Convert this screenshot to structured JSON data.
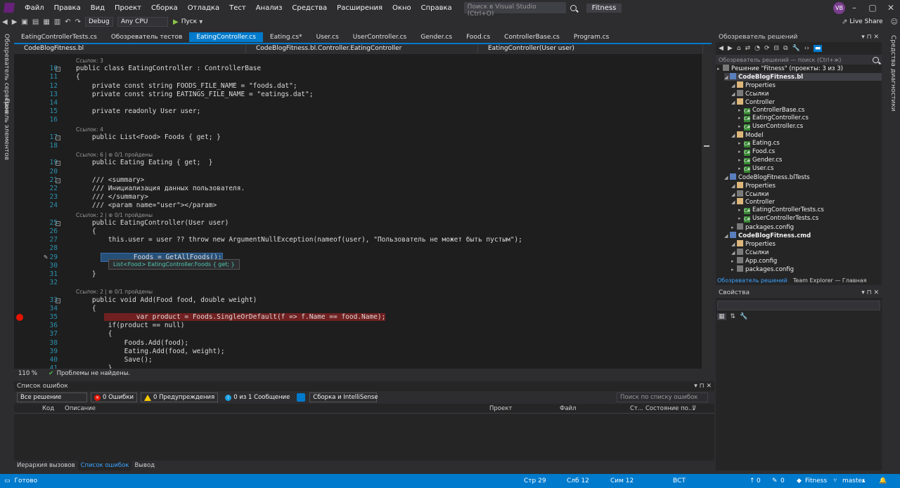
{
  "menu": [
    "Файл",
    "Правка",
    "Вид",
    "Проект",
    "Сборка",
    "Отладка",
    "Тест",
    "Анализ",
    "Средства",
    "Расширения",
    "Окно",
    "Справка"
  ],
  "search_placeholder": "Поиск в Visual Studio (Ctrl+Q)",
  "solution_title": "Fitness",
  "avatar_initials": "VB",
  "live_share": "Live Share",
  "toolbar": {
    "config": "Debug",
    "platform": "Any CPU",
    "run_label": "Пуск"
  },
  "doc_tabs": [
    "EatingControllerTests.cs",
    "Обозреватель тестов",
    "EatingController.cs",
    "Eating.cs*",
    "User.cs",
    "UserController.cs",
    "Gender.cs",
    "Food.cs",
    "ControllerBase.cs",
    "Program.cs"
  ],
  "nav": {
    "project": "CodeBlogFitness.bl",
    "class": "CodeBlogFitness.bl.Controller.EatingController",
    "member": "EatingController(User user)"
  },
  "left_strip": [
    "Обозреватель серверов",
    "Панель элементов"
  ],
  "right_strip": "Средства диагностики",
  "code_lines": [
    {
      "n": "",
      "lens": "Ссылок: 3"
    },
    {
      "n": "10",
      "text": "public class EatingController : ControllerBase"
    },
    {
      "n": "11",
      "text": "{"
    },
    {
      "n": "12",
      "text": "    private const string FOODS_FILE_NAME = \"foods.dat\";"
    },
    {
      "n": "13",
      "text": "    private const string EATINGS_FILE_NAME = \"eatings.dat\";"
    },
    {
      "n": "14",
      "text": ""
    },
    {
      "n": "15",
      "text": "    private readonly User user;"
    },
    {
      "n": "16",
      "text": ""
    },
    {
      "n": "",
      "lens": "Ссылок: 4"
    },
    {
      "n": "17",
      "text": "    public List<Food> Foods { get; }"
    },
    {
      "n": "18",
      "text": ""
    },
    {
      "n": "",
      "lens": "Ссылок: 6 | ⊗ 0/1 пройдены"
    },
    {
      "n": "19",
      "text": "    public Eating Eating { get;  }"
    },
    {
      "n": "20",
      "text": ""
    },
    {
      "n": "21",
      "text": "    /// <summary>"
    },
    {
      "n": "22",
      "text": "    /// Инициализация данных пользователя."
    },
    {
      "n": "23",
      "text": "    /// </summary>"
    },
    {
      "n": "24",
      "text": "    /// <param name=\"user\"></param>"
    },
    {
      "n": "",
      "lens": "Ссылок: 2 | ⊗ 0/1 пройдены"
    },
    {
      "n": "25",
      "text": "    public EatingController(User user)"
    },
    {
      "n": "26",
      "text": "    {"
    },
    {
      "n": "27",
      "text": "        this.user = user ?? throw new ArgumentNullException(nameof(user), \"Пользователь не может быть пустым\");"
    },
    {
      "n": "28",
      "text": ""
    },
    {
      "n": "29",
      "text": "        Foods = GetAllFoods();"
    },
    {
      "n": "30",
      "text": "        E"
    },
    {
      "n": "31",
      "text": "    }"
    },
    {
      "n": "32",
      "text": ""
    },
    {
      "n": "",
      "lens": "Ссылок: 2 | ⊗ 0/1 пройдены"
    },
    {
      "n": "33",
      "text": "    public void Add(Food food, double weight)"
    },
    {
      "n": "34",
      "text": "    {"
    },
    {
      "n": "35",
      "text": "        var product = Foods.SingleOrDefault(f => f.Name == food.Name);"
    },
    {
      "n": "36",
      "text": "        if(product == null)"
    },
    {
      "n": "37",
      "text": "        {"
    },
    {
      "n": "38",
      "text": "            Foods.Add(food);"
    },
    {
      "n": "39",
      "text": "            Eating.Add(food, weight);"
    },
    {
      "n": "40",
      "text": "            Save();"
    },
    {
      "n": "41",
      "text": "        }"
    }
  ],
  "tooltip": "List<Food> EatingController.Foods { get; }",
  "editor_status": {
    "zoom": "110 %",
    "problems": "Проблемы не найдены."
  },
  "error_list": {
    "title": "Список ошибок",
    "scope": "Все решение",
    "errors": "0 Ошибки",
    "warnings": "0 Предупреждения",
    "messages": "0 из 1 Сообщение",
    "build_filter": "Сборка и IntelliSense",
    "search_placeholder": "Поиск по списку ошибок",
    "columns": [
      "Код",
      "Описание",
      "Проект",
      "Файл",
      "Ст...",
      "Состояние по..."
    ]
  },
  "bottom_tabs": [
    "Иерархия вызовов",
    "Список ошибок",
    "Вывод"
  ],
  "solution_explorer": {
    "title": "Обозреватель решений",
    "search_placeholder": "Обозреватель решений — поиск (Ctrl+ж)",
    "items": [
      {
        "label": "Решение \"Fitness\" (проекты: 3 из 3)",
        "indent": 0,
        "kind": "sol"
      },
      {
        "label": "CodeBlogFitness.bl",
        "indent": 1,
        "kind": "prj",
        "bold": true
      },
      {
        "label": "Properties",
        "indent": 2,
        "kind": "fld"
      },
      {
        "label": "Ссылки",
        "indent": 2,
        "kind": "ref"
      },
      {
        "label": "Controller",
        "indent": 2,
        "kind": "fld"
      },
      {
        "label": "ControllerBase.cs",
        "indent": 3,
        "kind": "cs"
      },
      {
        "label": "EatingController.cs",
        "indent": 3,
        "kind": "cs"
      },
      {
        "label": "UserController.cs",
        "indent": 3,
        "kind": "cs"
      },
      {
        "label": "Model",
        "indent": 2,
        "kind": "fld"
      },
      {
        "label": "Eating.cs",
        "indent": 3,
        "kind": "cs"
      },
      {
        "label": "Food.cs",
        "indent": 3,
        "kind": "cs"
      },
      {
        "label": "Gender.cs",
        "indent": 3,
        "kind": "cs"
      },
      {
        "label": "User.cs",
        "indent": 3,
        "kind": "cs"
      },
      {
        "label": "CodeBlogFitness.blTests",
        "indent": 1,
        "kind": "prj"
      },
      {
        "label": "Properties",
        "indent": 2,
        "kind": "fld"
      },
      {
        "label": "Ссылки",
        "indent": 2,
        "kind": "ref"
      },
      {
        "label": "Controller",
        "indent": 2,
        "kind": "fld"
      },
      {
        "label": "EatingControllerTests.cs",
        "indent": 3,
        "kind": "cs"
      },
      {
        "label": "UserControllerTests.cs",
        "indent": 3,
        "kind": "cs"
      },
      {
        "label": "packages.config",
        "indent": 2,
        "kind": "cfg"
      },
      {
        "label": "CodeBlogFitness.cmd",
        "indent": 1,
        "kind": "prj",
        "bold": true
      },
      {
        "label": "Properties",
        "indent": 2,
        "kind": "fld"
      },
      {
        "label": "Ссылки",
        "indent": 2,
        "kind": "ref"
      },
      {
        "label": "App.config",
        "indent": 2,
        "kind": "cfg"
      },
      {
        "label": "packages.config",
        "indent": 2,
        "kind": "cfg"
      }
    ],
    "tabs": [
      "Обозреватель решений",
      "Team Explorer — Главная"
    ]
  },
  "properties_title": "Свойства",
  "status": {
    "ready": "Готово",
    "line": "Стр 29",
    "col": "Слб 12",
    "ch": "Сим 12",
    "mode": "ВСТ",
    "up": "0",
    "edits": "0",
    "repo": "Fitness",
    "branch": "master"
  }
}
